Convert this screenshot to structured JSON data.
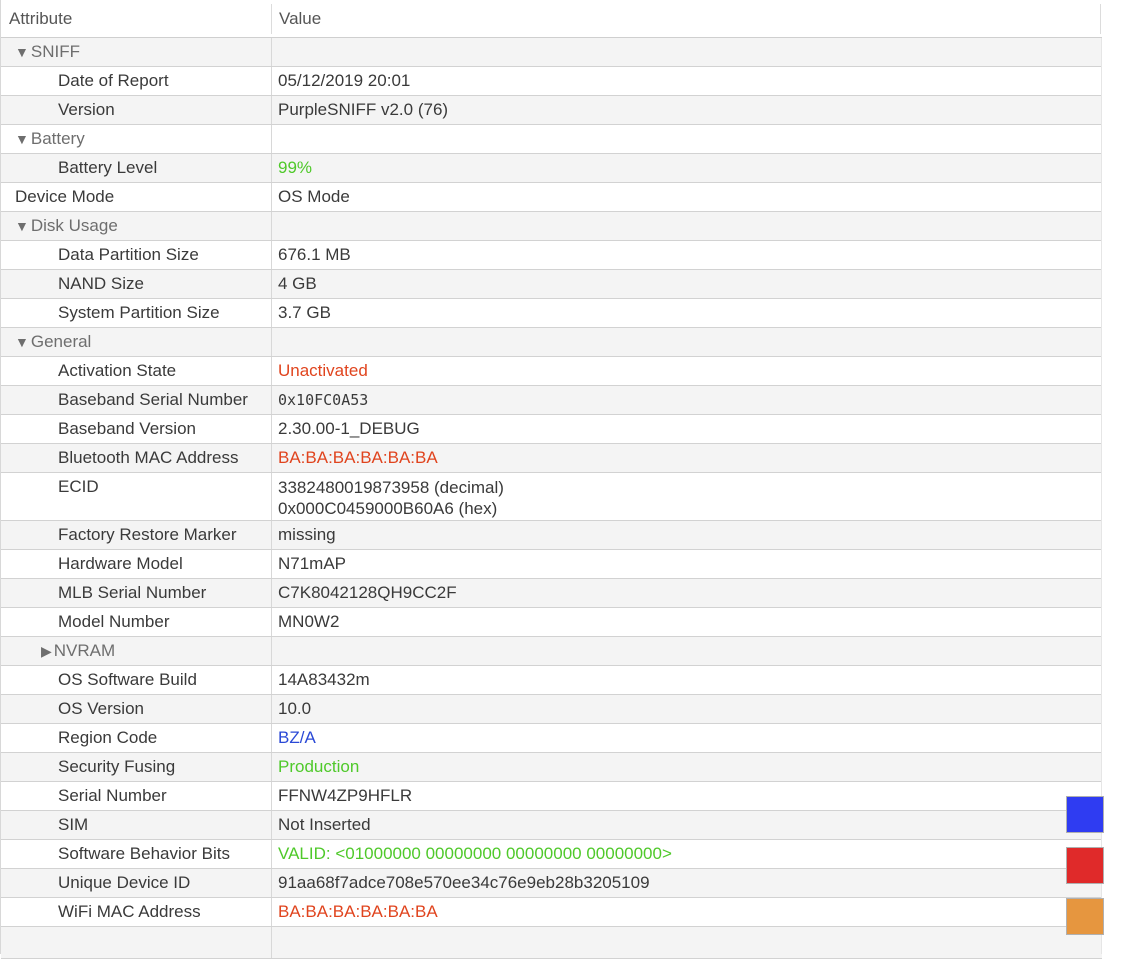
{
  "header": {
    "attribute": "Attribute",
    "value": "Value"
  },
  "rows": [
    {
      "attr": "SNIFF",
      "val": "",
      "indent": 1,
      "group": "open"
    },
    {
      "attr": "Date of Report",
      "val": "05/12/2019 20:01",
      "indent": 2
    },
    {
      "attr": "Version",
      "val": "PurpleSNIFF v2.0 (76)",
      "indent": 2
    },
    {
      "attr": "Battery",
      "val": "",
      "indent": 1,
      "group": "open"
    },
    {
      "attr": "Battery Level",
      "val": "99%",
      "indent": 2,
      "color": "green"
    },
    {
      "attr": "Device Mode",
      "val": "OS Mode",
      "indent": 1
    },
    {
      "attr": "Disk Usage",
      "val": "",
      "indent": 1,
      "group": "open"
    },
    {
      "attr": "Data Partition Size",
      "val": "676.1 MB",
      "indent": 2
    },
    {
      "attr": "NAND Size",
      "val": "4 GB",
      "indent": 2
    },
    {
      "attr": "System Partition Size",
      "val": "3.7 GB",
      "indent": 2
    },
    {
      "attr": "General",
      "val": "",
      "indent": 1,
      "group": "open"
    },
    {
      "attr": "Activation State",
      "val": "Unactivated",
      "indent": 2,
      "color": "red"
    },
    {
      "attr": "Baseband Serial Number",
      "val": "0x10FC0A53",
      "indent": 2,
      "mono": true
    },
    {
      "attr": "Baseband Version",
      "val": "2.30.00-1_DEBUG",
      "indent": 2
    },
    {
      "attr": "Bluetooth MAC Address",
      "val": "BA:BA:BA:BA:BA:BA",
      "indent": 2,
      "color": "red"
    },
    {
      "attr": "ECID",
      "val": "3382480019873958 (decimal)",
      "val2": "0x000C0459000B60A6 (hex)",
      "indent": 2,
      "tall": true
    },
    {
      "attr": "Factory Restore Marker",
      "val": "missing",
      "indent": 2
    },
    {
      "attr": "Hardware Model",
      "val": "N71mAP",
      "indent": 2
    },
    {
      "attr": "MLB Serial Number",
      "val": "C7K8042128QH9CC2F",
      "indent": 2
    },
    {
      "attr": "Model Number",
      "val": "MN0W2",
      "indent": 2
    },
    {
      "attr": "NVRAM",
      "val": "",
      "indent": 3,
      "group": "closed"
    },
    {
      "attr": "OS Software Build",
      "val": "14A83432m",
      "indent": 2
    },
    {
      "attr": "OS Version",
      "val": "10.0",
      "indent": 2
    },
    {
      "attr": "Region Code",
      "val": "BZ/A",
      "indent": 2,
      "color": "blue"
    },
    {
      "attr": "Security Fusing",
      "val": "Production",
      "indent": 2,
      "color": "green"
    },
    {
      "attr": "Serial Number",
      "val": "FFNW4ZP9HFLR",
      "indent": 2
    },
    {
      "attr": "SIM",
      "val": "Not Inserted",
      "indent": 2
    },
    {
      "attr": "Software Behavior Bits",
      "val": "VALID: <01000000 00000000 00000000 00000000>",
      "indent": 2,
      "color": "green"
    },
    {
      "attr": "Unique Device ID",
      "val": "91aa68f7adce708e570ee34c76e9eb28b3205109",
      "indent": 2
    },
    {
      "attr": "WiFi MAC Address",
      "val": "BA:BA:BA:BA:BA:BA",
      "indent": 2,
      "color": "red"
    },
    {
      "attr": "",
      "val": "",
      "indent": 2
    }
  ],
  "swatches": [
    {
      "name": "blue-swatch",
      "color": "#2f3cf2"
    },
    {
      "name": "red-swatch",
      "color": "#e02a2a"
    },
    {
      "name": "orange-swatch",
      "color": "#e6963f"
    }
  ],
  "icons": {
    "expanded": "triangle-down-icon",
    "collapsed": "triangle-right-icon"
  }
}
